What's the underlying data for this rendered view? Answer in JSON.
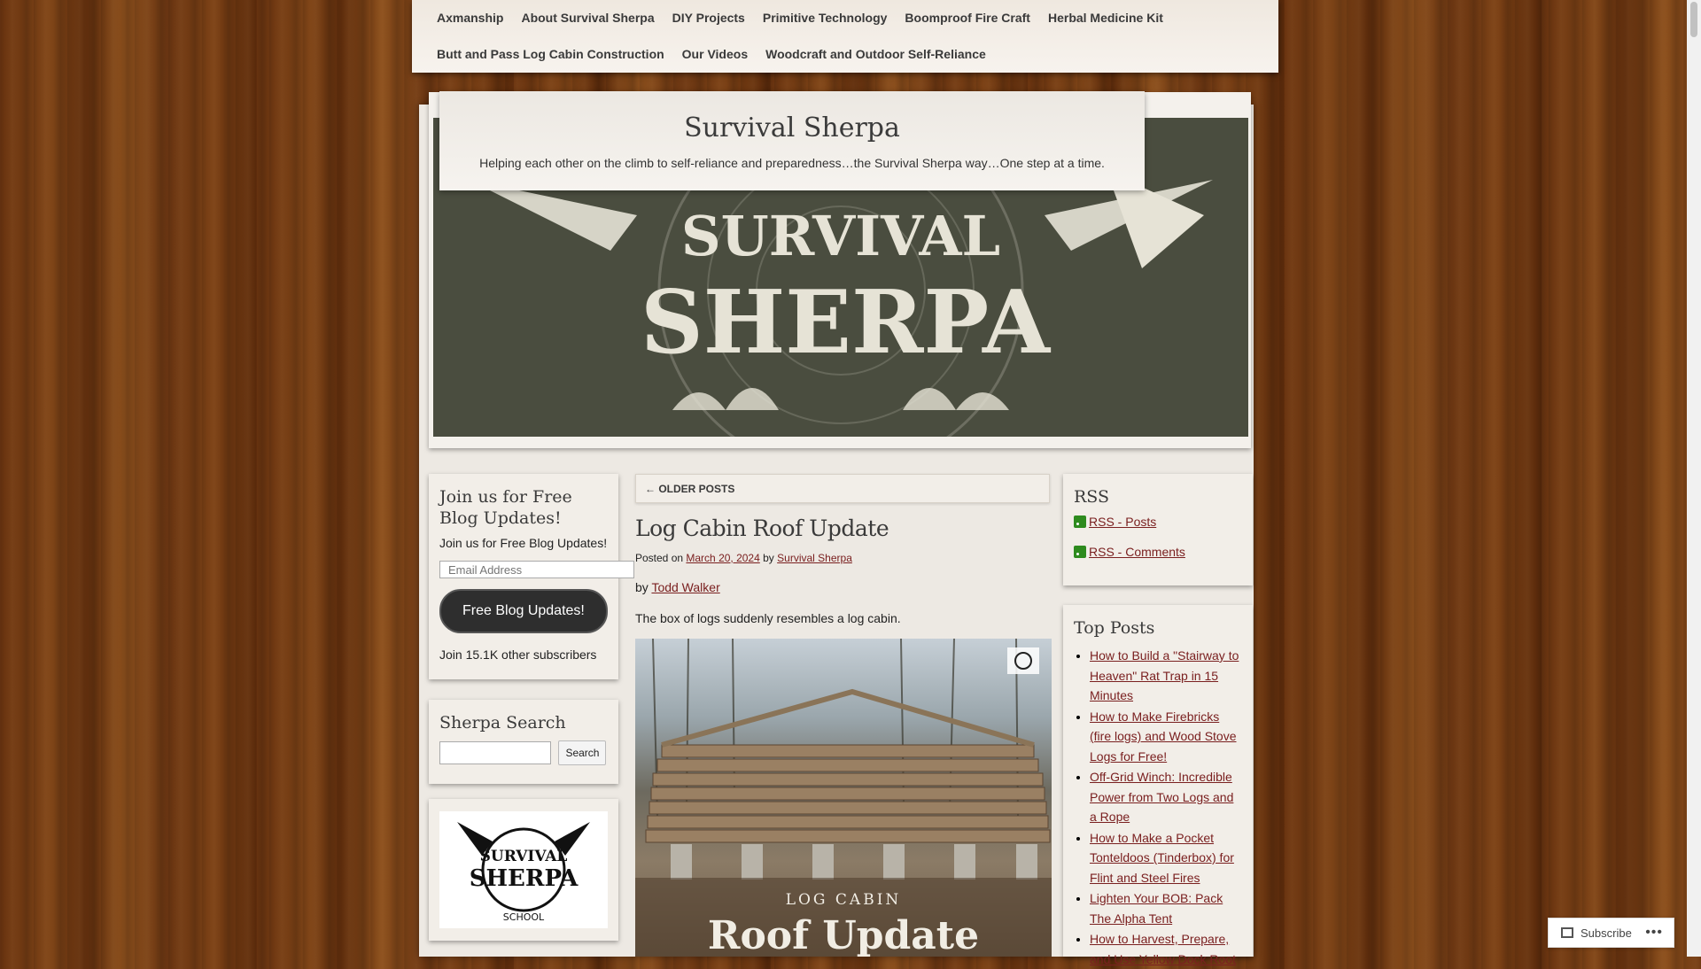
{
  "nav": {
    "items": [
      "Axmanship",
      "About Survival Sherpa",
      "DIY Projects",
      "Primitive Technology",
      "Boomproof Fire Craft",
      "Herbal Medicine Kit",
      "Butt and Pass Log Cabin Construction",
      "Our Videos",
      "Woodcraft and Outdoor Self-Reliance"
    ]
  },
  "site": {
    "title": "Survival Sherpa",
    "description": "Helping each other on the climb to self-reliance and preparedness…the Survival Sherpa way…One step at a time.",
    "banner_line1": "SURVIVAL",
    "banner_line2": "SHERPA"
  },
  "left_sidebar": {
    "subscribe_widget": {
      "title": "Join us for Free Blog Updates!",
      "text": "Join us for Free Blog Updates!",
      "email_placeholder": "Email Address",
      "button": "Free Blog Updates!",
      "subscribers": "Join 15.1K other subscribers"
    },
    "search_widget": {
      "title": "Sherpa Search",
      "button": "Search"
    },
    "school_logo": {
      "line1": "SURVIVAL",
      "line2": "SHERPA",
      "line3": "SCHOOL"
    }
  },
  "main": {
    "older_posts": "← OLDER POSTS",
    "post": {
      "title": "Log Cabin Roof Update",
      "posted_on": "Posted on",
      "date": "March 20, 2024",
      "by": "by",
      "author": "Survival Sherpa",
      "byline_prefix": "by",
      "byline_author": "Todd Walker",
      "intro": "The box of logs suddenly resembles a log cabin.",
      "image_caption_small": "LOG CABIN",
      "image_caption_large": "Roof Update"
    }
  },
  "right_sidebar": {
    "rss": {
      "title": "RSS",
      "links": [
        "RSS - Posts",
        "RSS - Comments"
      ]
    },
    "top_posts": {
      "title": "Top Posts",
      "items": [
        "How to Build a \"Stairway to Heaven\" Rat Trap in 15 Minutes",
        "How to Make Firebricks (fire logs) and Wood Stove Logs for Free!",
        "Off-Grid Winch: Incredible Power from Two Logs and a Rope",
        "How to Make a Pocket Tonteldoos (Tinderbox) for Flint and Steel Fires",
        "Lighten Your BOB: Pack The Alpha Tent",
        "How to Harvest, Prepare, and Use Yellow Dock Root"
      ]
    }
  },
  "floating": {
    "subscribe": "Subscribe",
    "more": "•••"
  },
  "colors": {
    "banner_bg": "#4a4d3f",
    "banner_ink": "#e6e3d6",
    "link": "#7a2020",
    "paper": "#ede9e3"
  }
}
